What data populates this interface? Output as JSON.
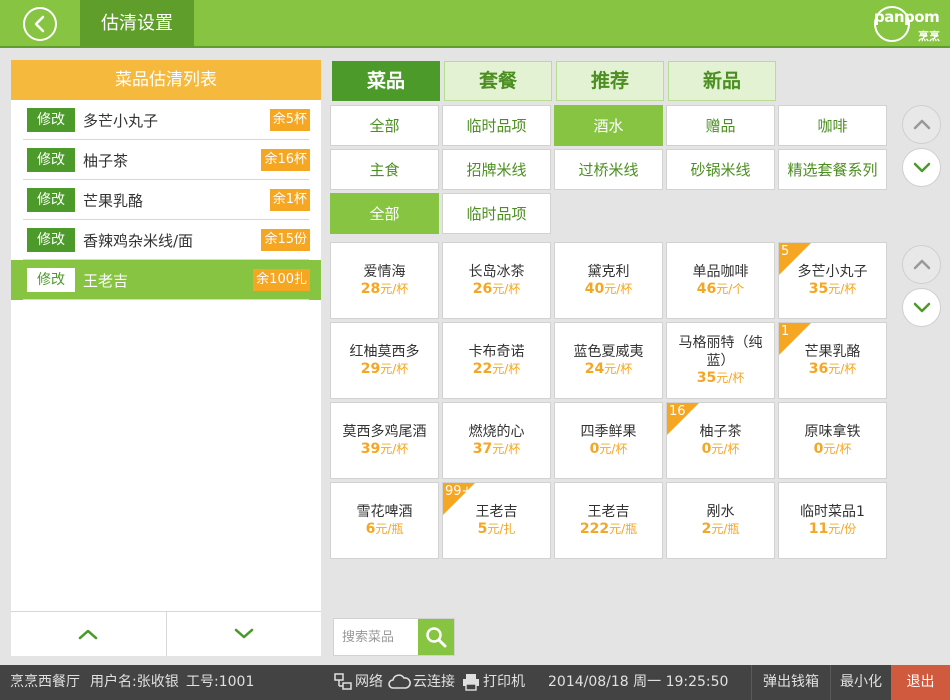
{
  "header": {
    "title": "估清设置",
    "logo_brand": "panpom",
    "logo_sub": "烹烹"
  },
  "left_panel": {
    "title": "菜品估清列表",
    "items": [
      {
        "modify_label": "修改",
        "name": "多芒小丸子",
        "remaining": "余5杯",
        "selected": false
      },
      {
        "modify_label": "修改",
        "name": "柚子茶",
        "remaining": "余16杯",
        "selected": false
      },
      {
        "modify_label": "修改",
        "name": "芒果乳酪",
        "remaining": "余1杯",
        "selected": false
      },
      {
        "modify_label": "修改",
        "name": "香辣鸡杂米线/面",
        "remaining": "余15份",
        "selected": false
      },
      {
        "modify_label": "修改",
        "name": "王老吉",
        "remaining": "余100扎",
        "selected": true
      }
    ]
  },
  "category_tabs": [
    {
      "label": "菜品",
      "active": true
    },
    {
      "label": "套餐",
      "active": false
    },
    {
      "label": "推荐",
      "active": false
    },
    {
      "label": "新品",
      "active": false
    }
  ],
  "subcategories_row1": [
    {
      "label": "全部",
      "active": false
    },
    {
      "label": "临时品项",
      "active": false
    },
    {
      "label": "酒水",
      "active": true
    },
    {
      "label": "赠品",
      "active": false
    },
    {
      "label": "咖啡",
      "active": false
    }
  ],
  "subcategories_row2": [
    {
      "label": "主食",
      "active": false
    },
    {
      "label": "招牌米线",
      "active": false
    },
    {
      "label": "过桥米线",
      "active": false
    },
    {
      "label": "砂锅米线",
      "active": false
    },
    {
      "label": "精选套餐系列",
      "active": false
    }
  ],
  "subsubcategories": [
    {
      "label": "全部",
      "active": true
    },
    {
      "label": "临时品项",
      "active": false
    }
  ],
  "products": [
    {
      "name": "爱情海",
      "price": "28",
      "unit": "元/杯",
      "badge": ""
    },
    {
      "name": "长岛冰茶",
      "price": "26",
      "unit": "元/杯",
      "badge": ""
    },
    {
      "name": "黛克利",
      "price": "40",
      "unit": "元/杯",
      "badge": ""
    },
    {
      "name": "单品咖啡",
      "price": "46",
      "unit": "元/个",
      "badge": ""
    },
    {
      "name": "多芒小丸子",
      "price": "35",
      "unit": "元/杯",
      "badge": "5"
    },
    {
      "name": "红柚莫西多",
      "price": "29",
      "unit": "元/杯",
      "badge": ""
    },
    {
      "name": "卡布奇诺",
      "price": "22",
      "unit": "元/杯",
      "badge": ""
    },
    {
      "name": "蓝色夏威夷",
      "price": "24",
      "unit": "元/杯",
      "badge": ""
    },
    {
      "name": "马格丽特（纯蓝）",
      "price": "35",
      "unit": "元/杯",
      "badge": ""
    },
    {
      "name": "芒果乳酪",
      "price": "36",
      "unit": "元/杯",
      "badge": "1"
    },
    {
      "name": "莫西多鸡尾酒",
      "price": "39",
      "unit": "元/杯",
      "badge": ""
    },
    {
      "name": "燃烧的心",
      "price": "37",
      "unit": "元/杯",
      "badge": ""
    },
    {
      "name": "四季鲜果",
      "price": "0",
      "unit": "元/杯",
      "badge": ""
    },
    {
      "name": "柚子茶",
      "price": "0",
      "unit": "元/杯",
      "badge": "16"
    },
    {
      "name": "原味拿铁",
      "price": "0",
      "unit": "元/杯",
      "badge": ""
    },
    {
      "name": "雪花啤酒",
      "price": "6",
      "unit": "元/瓶",
      "badge": ""
    },
    {
      "name": "王老吉",
      "price": "5",
      "unit": "元/扎",
      "badge": "99+"
    },
    {
      "name": "王老吉",
      "price": "222",
      "unit": "元/瓶",
      "badge": ""
    },
    {
      "name": "剐水",
      "price": "2",
      "unit": "元/瓶",
      "badge": ""
    },
    {
      "name": "临时菜品1",
      "price": "11",
      "unit": "元/份",
      "badge": ""
    }
  ],
  "search": {
    "placeholder": "搜索菜品",
    "value": ""
  },
  "status_bar": {
    "restaurant": "烹烹西餐厅",
    "user": "用户名:张收银",
    "employee_id": "工号:1001",
    "network": "网络",
    "cloud": "云连接",
    "printer": "打印机",
    "datetime": "2014/08/18 周一  19:25:50",
    "cash_drawer": "弹出钱箱",
    "minimize": "最小化",
    "exit": "退出"
  },
  "colors": {
    "brand_green": "#86c441",
    "dark_green": "#4c9a2a",
    "orange": "#f5a623",
    "status_bg": "#434343",
    "exit_red": "#d05a3e"
  }
}
